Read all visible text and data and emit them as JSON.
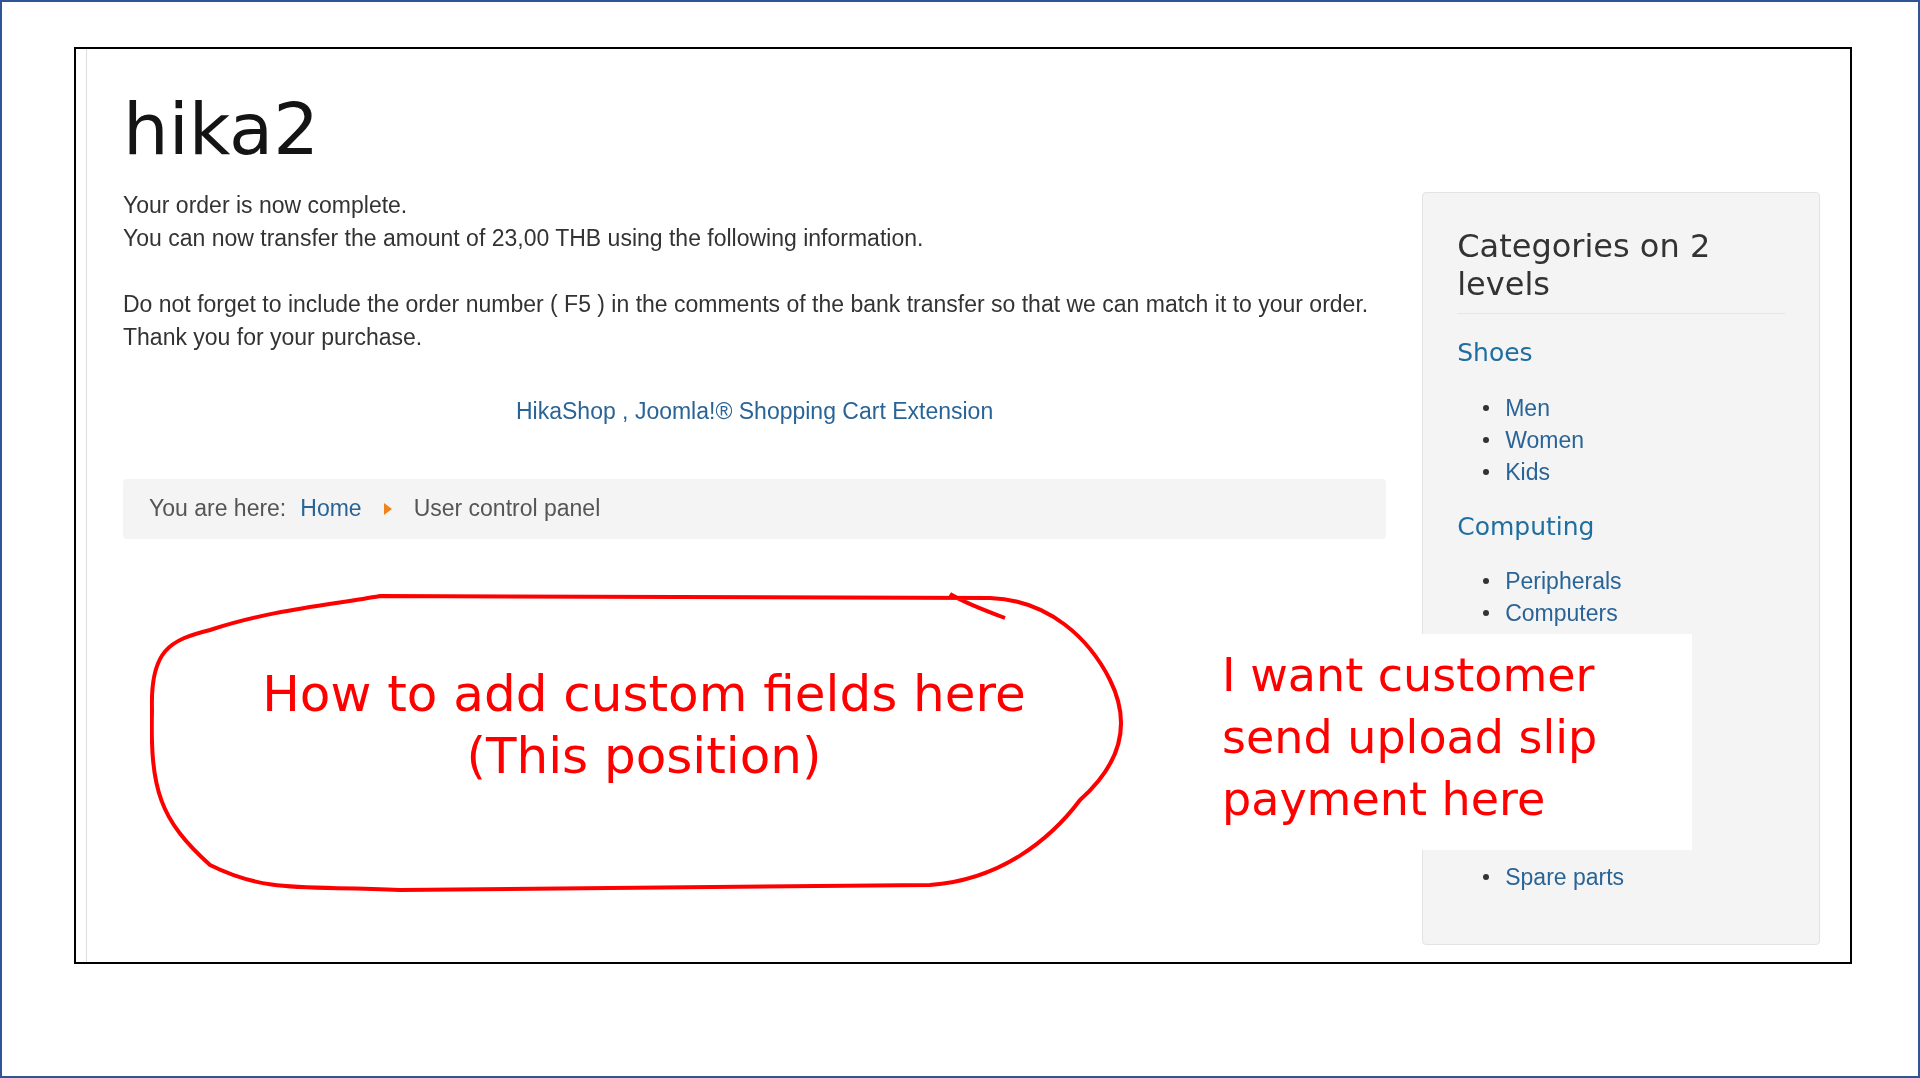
{
  "page": {
    "title": "hika2",
    "message": [
      [
        "Your order is now complete.",
        "You can now transfer the amount of 23,00 THB using the following information."
      ],
      [
        "Do not forget to include the order number ( F5 ) in the comments of the bank transfer so that we can match it to your order.",
        "Thank you for your purchase."
      ]
    ],
    "footer_link": "HikaShop , Joomla!® Shopping Cart Extension",
    "breadcrumb": {
      "label": "You are here:",
      "items": [
        {
          "text": "Home",
          "link": true
        },
        {
          "text": "User control panel",
          "link": false
        }
      ]
    }
  },
  "sidebar": {
    "title": "Categories on 2 levels",
    "groups": [
      {
        "name": "Shoes",
        "items": [
          "Men",
          "Women",
          "Kids"
        ]
      },
      {
        "name": "Computing",
        "items": [
          "Peripherals",
          "Computers"
        ]
      },
      {
        "items": [
          "Spare parts"
        ]
      }
    ]
  },
  "annotations": [
    {
      "kind": "circled",
      "text": "How to add custom fields here\n(This position)"
    },
    {
      "kind": "note",
      "text": "I want customer\nsend upload slip\npayment here"
    }
  ]
}
